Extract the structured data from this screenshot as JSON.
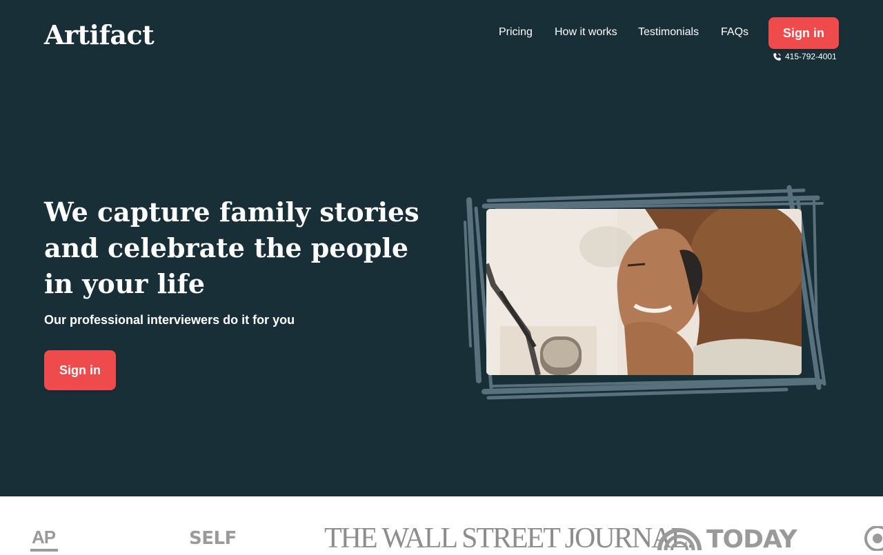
{
  "header": {
    "logo": "Artifact",
    "nav": [
      {
        "label": "Pricing"
      },
      {
        "label": "How it works"
      },
      {
        "label": "Testimonials"
      },
      {
        "label": "FAQs"
      }
    ],
    "sign_in_label": "Sign in",
    "phone_icon": "phone-icon",
    "phone": "415-792-4001"
  },
  "hero": {
    "headline": "We capture family stories and celebrate the people in your life",
    "subheadline": "Our professional interviewers do it for you",
    "cta_label": "Sign in",
    "image": "woman-with-headphones-laughing-at-microphone"
  },
  "press": {
    "logos": [
      "AP",
      "SELF",
      "THE WALL STREET JOURNAL.",
      "TODAY"
    ],
    "icons": [
      "today-rainbow-icon",
      "cbs-eye-icon"
    ]
  },
  "colors": {
    "background": "#192f38",
    "accent": "#ef4b4c",
    "scribble": "#58717c",
    "logos": "#9a9a9a"
  }
}
